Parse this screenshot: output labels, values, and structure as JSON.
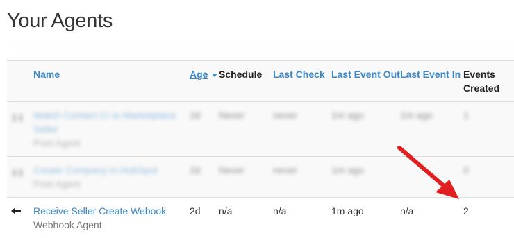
{
  "page": {
    "title": "Your Agents"
  },
  "table": {
    "headers": {
      "name": "Name",
      "age": "Age",
      "schedule": "Schedule",
      "last_check": "Last Check",
      "last_event_out": "Last Event Out",
      "last_event_in": "Last Event In",
      "events_created": "Events Created"
    },
    "rows": [
      {
        "status_icon": "pause-icon",
        "name": "Watch Contact Cr to Marketplace Seller",
        "type": "Post Agent",
        "age": "2d",
        "schedule": "Never",
        "last_check": "never",
        "last_event_out": "1m ago",
        "last_event_in": "1m ago",
        "events_created": "1"
      },
      {
        "status_icon": "pause-icon",
        "name": "Create Company in HubSpot",
        "type": "Post Agent",
        "age": "2d",
        "schedule": "Never",
        "last_check": "never",
        "last_event_out": "1m ago",
        "last_event_in": "",
        "events_created": "0"
      },
      {
        "status_icon": "left-arrow-icon",
        "name": "Receive Seller Create Webook",
        "type": "Webhook Agent",
        "age": "2d",
        "schedule": "n/a",
        "last_check": "n/a",
        "last_event_out": "1m ago",
        "last_event_in": "n/a",
        "events_created": "2"
      }
    ]
  },
  "colors": {
    "link": "#3a88c7",
    "annotation_arrow": "#e02020"
  }
}
